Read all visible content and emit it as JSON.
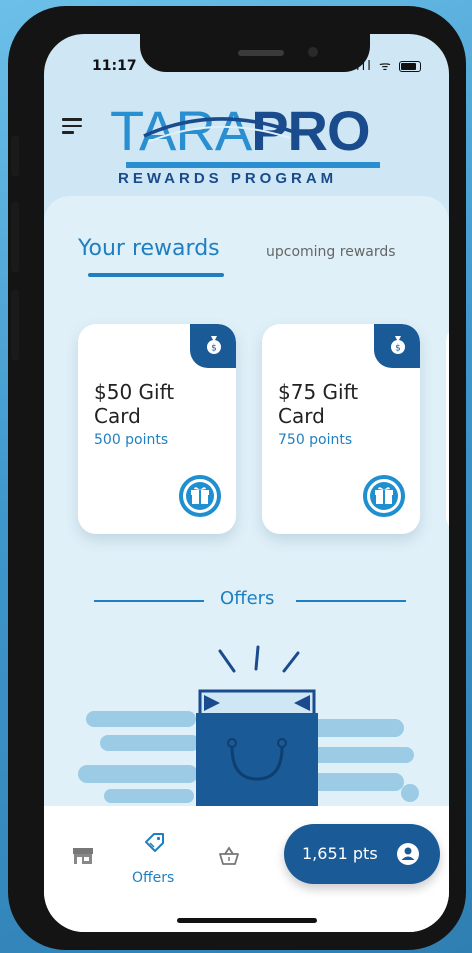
{
  "status_bar": {
    "time": "11:17",
    "icons": "ıll ᯤ"
  },
  "header": {
    "logo_tara": "TARA",
    "logo_pro": "PRO",
    "logo_sub": "REWARDS PROGRAM"
  },
  "tabs": {
    "active": "Your rewards",
    "inactive": "upcoming rewards"
  },
  "rewards": [
    {
      "title": "$50 Gift Card",
      "points": "500 points"
    },
    {
      "title": "$75 Gift Card",
      "points": "750 points"
    }
  ],
  "offers_heading": "Offers",
  "bottom_nav": {
    "offers_label": "Offers",
    "points": "1,651 pts"
  },
  "colors": {
    "primary": "#1f7fc0",
    "dark": "#1a5a96",
    "background": "#cfe7f4"
  }
}
